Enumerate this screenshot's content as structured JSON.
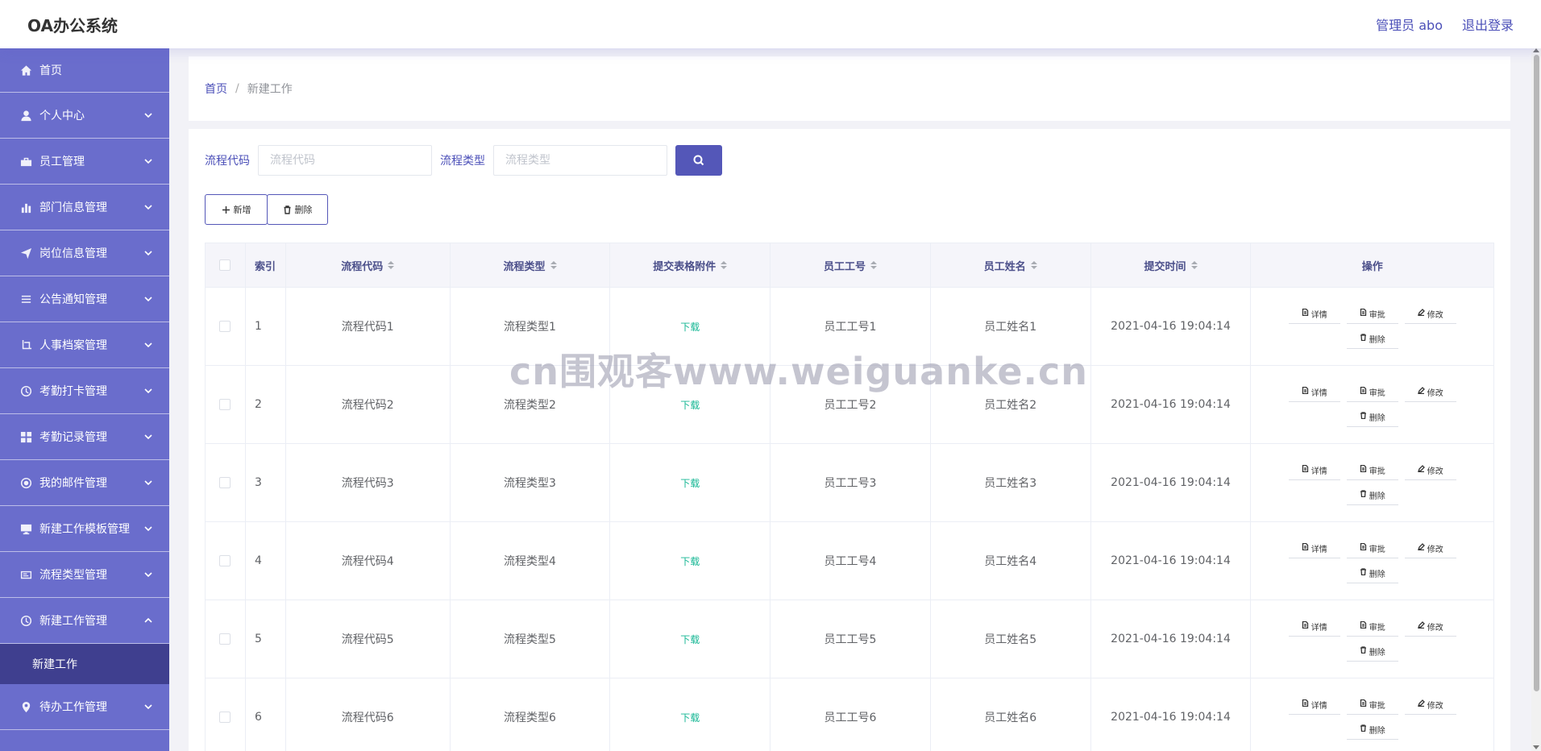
{
  "app": {
    "title": "OA办公系统"
  },
  "header": {
    "user": "管理员 abo",
    "logout": "退出登录"
  },
  "sidebar": {
    "items": [
      {
        "label": "首页",
        "icon": "home-icon"
      },
      {
        "label": "个人中心",
        "icon": "user-icon"
      },
      {
        "label": "员工管理",
        "icon": "briefcase-icon"
      },
      {
        "label": "部门信息管理",
        "icon": "bar-chart-icon"
      },
      {
        "label": "岗位信息管理",
        "icon": "send-icon"
      },
      {
        "label": "公告通知管理",
        "icon": "list-icon"
      },
      {
        "label": "人事档案管理",
        "icon": "crop-icon"
      },
      {
        "label": "考勤打卡管理",
        "icon": "clock-icon"
      },
      {
        "label": "考勤记录管理",
        "icon": "grid-icon"
      },
      {
        "label": "我的邮件管理",
        "icon": "mail-circle-icon"
      },
      {
        "label": "新建工作模板管理",
        "icon": "monitor-icon"
      },
      {
        "label": "流程类型管理",
        "icon": "card-icon"
      },
      {
        "label": "新建工作管理",
        "icon": "clock-icon"
      },
      {
        "label": "待办工作管理",
        "icon": "location-icon"
      }
    ],
    "submenu": {
      "label": "新建工作"
    }
  },
  "breadcrumb": {
    "home": "首页",
    "separator": "/",
    "current": "新建工作"
  },
  "search": {
    "code_label": "流程代码",
    "code_placeholder": "流程代码",
    "type_label": "流程类型",
    "type_placeholder": "流程类型"
  },
  "actions": {
    "add": "新增",
    "delete": "删除"
  },
  "table": {
    "headers": {
      "index": "索引",
      "code": "流程代码",
      "type": "流程类型",
      "file": "提交表格附件",
      "emp_no": "员工工号",
      "emp_name": "员工姓名",
      "time": "提交时间",
      "ops": "操作"
    },
    "download_label": "下载",
    "op_labels": {
      "detail": "详情",
      "approve": "审批",
      "edit": "修改",
      "delete": "删除"
    },
    "rows": [
      {
        "index": "1",
        "code": "流程代码1",
        "type": "流程类型1",
        "emp_no": "员工工号1",
        "emp_name": "员工姓名1",
        "time": "2021-04-16 19:04:14"
      },
      {
        "index": "2",
        "code": "流程代码2",
        "type": "流程类型2",
        "emp_no": "员工工号2",
        "emp_name": "员工姓名2",
        "time": "2021-04-16 19:04:14"
      },
      {
        "index": "3",
        "code": "流程代码3",
        "type": "流程类型3",
        "emp_no": "员工工号3",
        "emp_name": "员工姓名3",
        "time": "2021-04-16 19:04:14"
      },
      {
        "index": "4",
        "code": "流程代码4",
        "type": "流程类型4",
        "emp_no": "员工工号4",
        "emp_name": "员工姓名4",
        "time": "2021-04-16 19:04:14"
      },
      {
        "index": "5",
        "code": "流程代码5",
        "type": "流程类型5",
        "emp_no": "员工工号5",
        "emp_name": "员工姓名5",
        "time": "2021-04-16 19:04:14"
      },
      {
        "index": "6",
        "code": "流程代码6",
        "type": "流程类型6",
        "emp_no": "员工工号6",
        "emp_name": "员工姓名6",
        "time": "2021-04-16 19:04:14"
      }
    ]
  },
  "watermark": "cn围观客www.weiguanke.cn",
  "colors": {
    "sidebar": "#6a6dcc",
    "sidebar_active": "#3f3f8f",
    "accent": "#5457b8",
    "download": "#16b794"
  }
}
